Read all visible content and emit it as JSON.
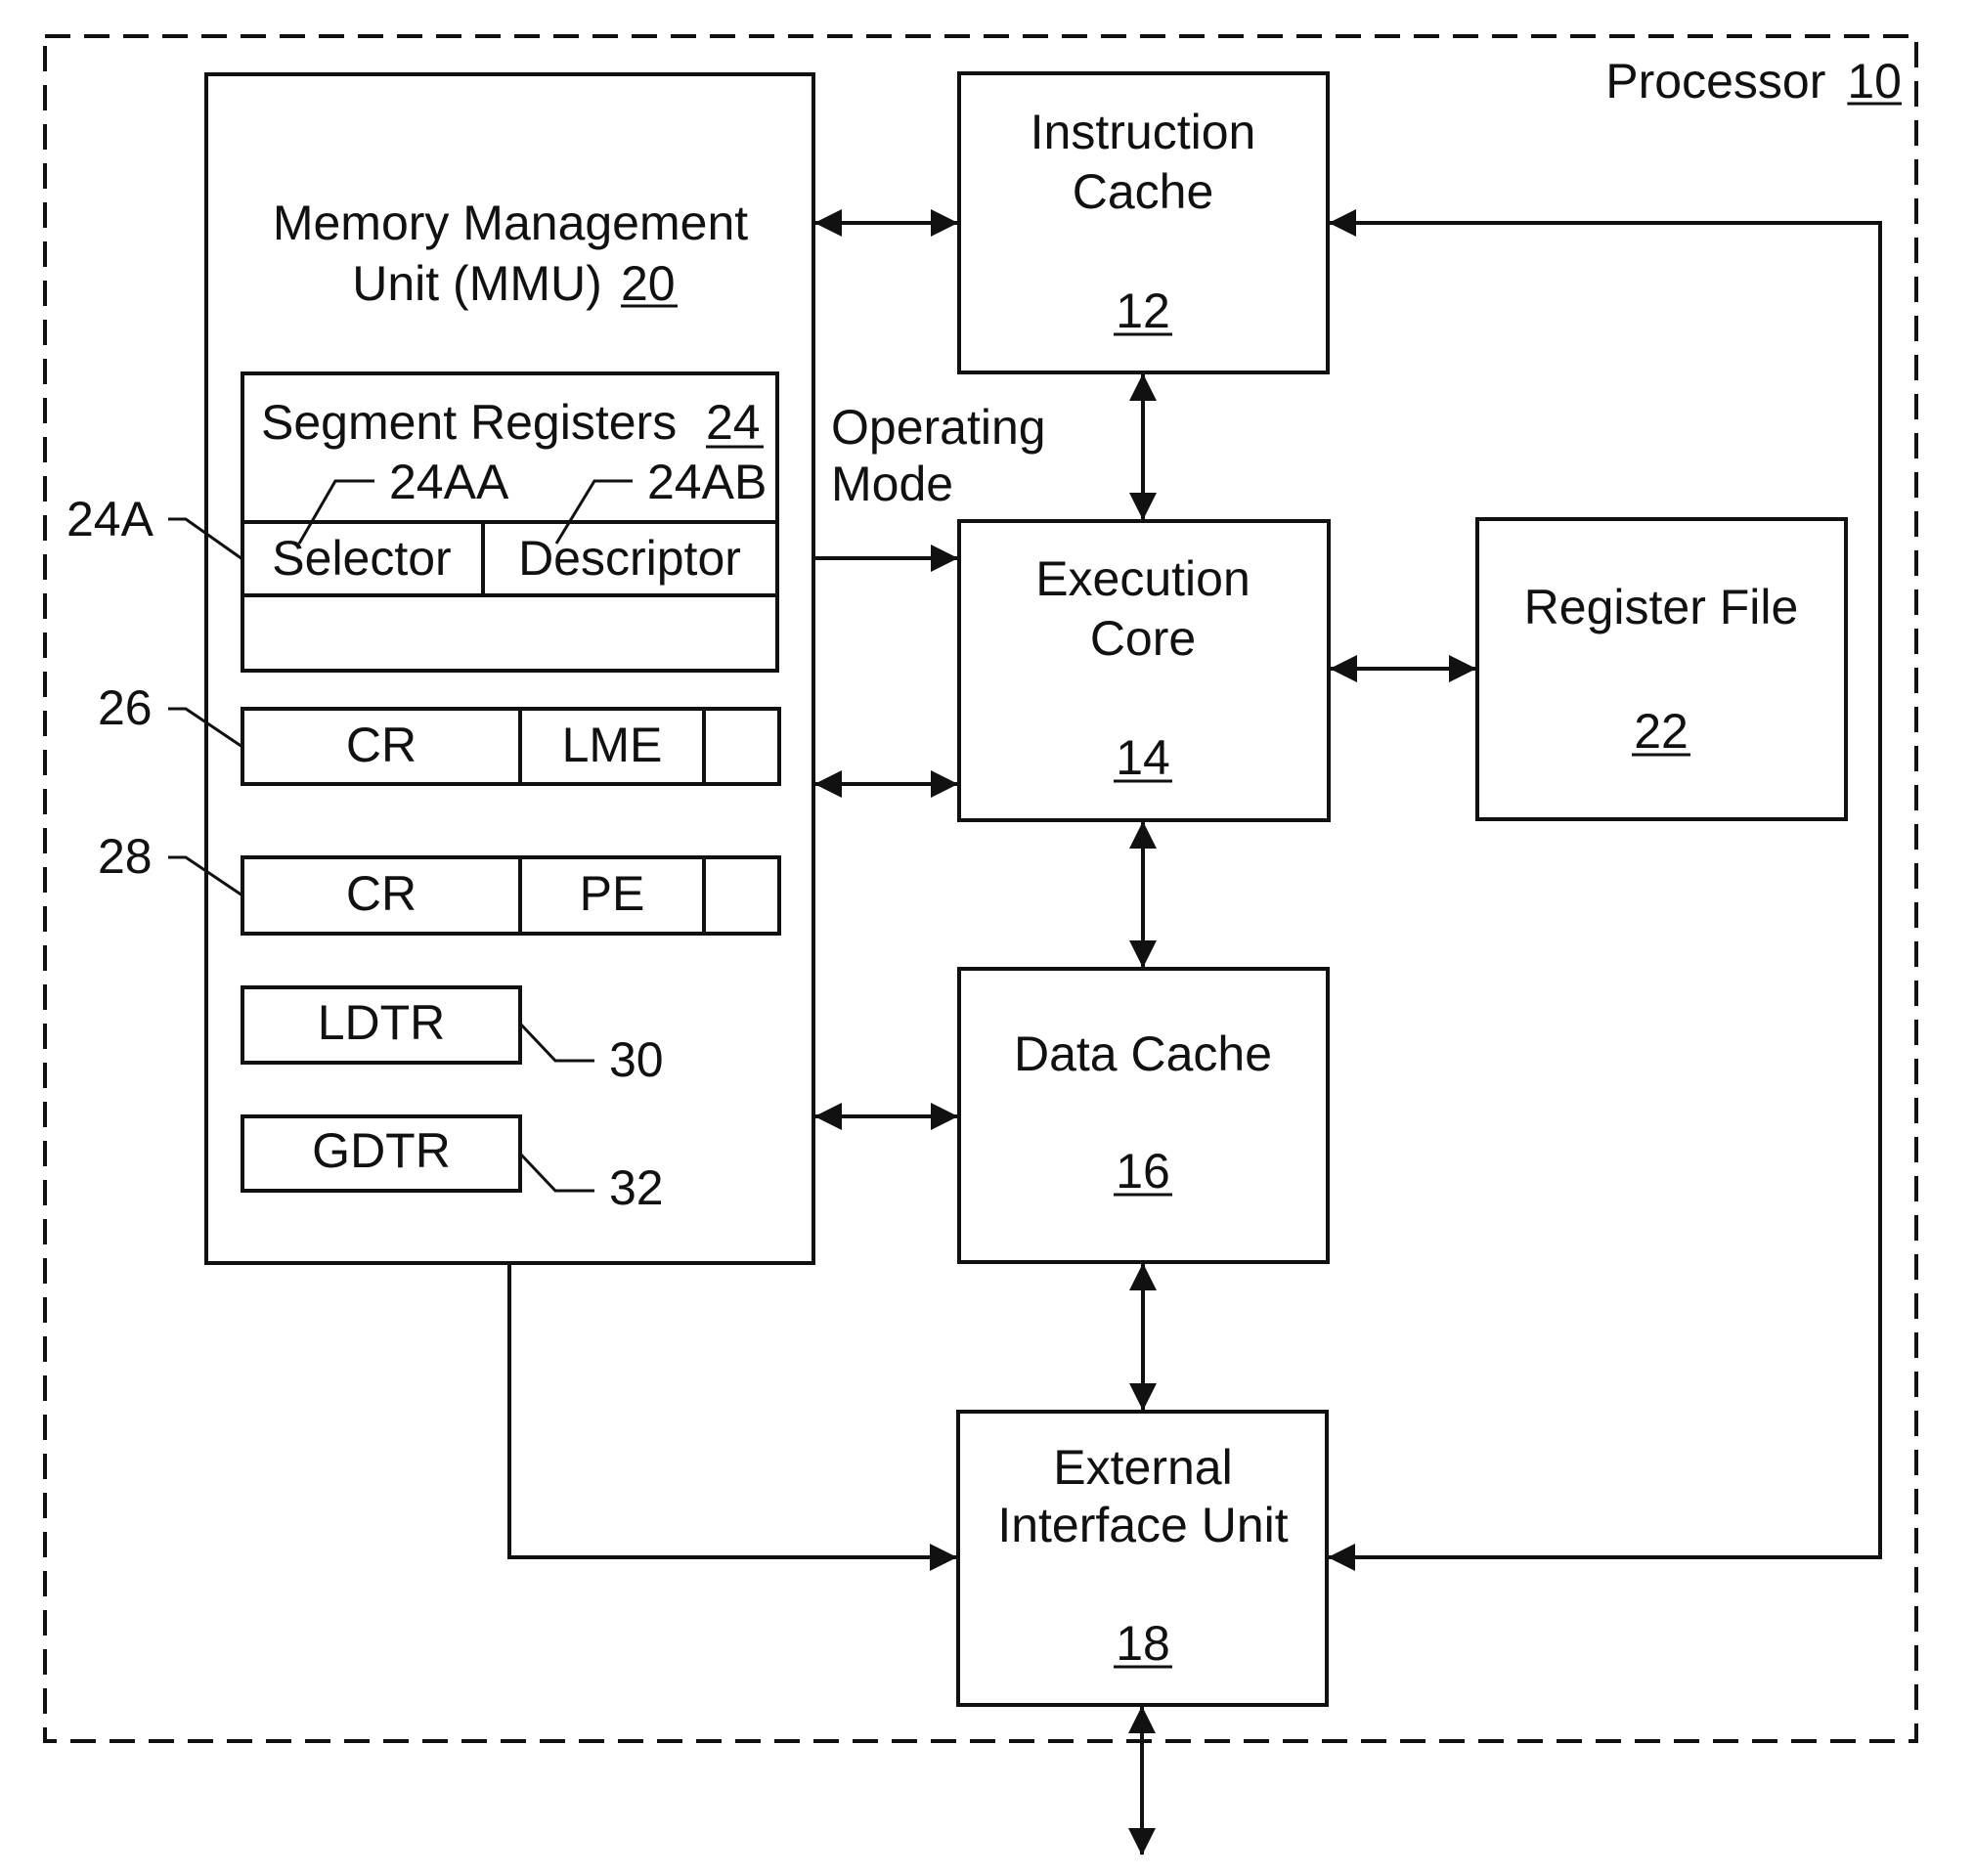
{
  "diagram": {
    "processor": {
      "label": "Processor",
      "ref": "10"
    },
    "mmu": {
      "title_line1": "Memory Management",
      "title_line2": "Unit (MMU)",
      "ref": "20",
      "segment_registers": {
        "label": "Segment Registers",
        "ref": "24",
        "entry_ref": "24A",
        "selector": {
          "label": "Selector",
          "ref": "24AA"
        },
        "descriptor": {
          "label": "Descriptor",
          "ref": "24AB"
        }
      },
      "cr_lme": {
        "ref": "26",
        "field1": "CR",
        "field2": "LME"
      },
      "cr_pe": {
        "ref": "28",
        "field1": "CR",
        "field2": "PE"
      },
      "ldtr": {
        "label": "LDTR",
        "ref": "30"
      },
      "gdtr": {
        "label": "GDTR",
        "ref": "32"
      }
    },
    "instruction_cache": {
      "line1": "Instruction",
      "line2": "Cache",
      "ref": "12"
    },
    "execution_core": {
      "line1": "Execution",
      "line2": "Core",
      "ref": "14"
    },
    "data_cache": {
      "line1": "Data Cache",
      "ref": "16"
    },
    "external_interface_unit": {
      "line1": "External",
      "line2": "Interface Unit",
      "ref": "18"
    },
    "register_file": {
      "line1": "Register File",
      "ref": "22"
    },
    "operating_mode": {
      "line1": "Operating",
      "line2": "Mode"
    }
  }
}
